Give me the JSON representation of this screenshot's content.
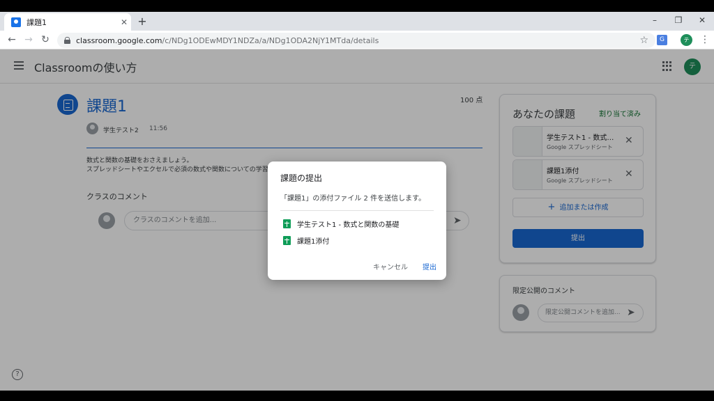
{
  "browser": {
    "tab_title": "課題1",
    "tab_close": "✕",
    "new_tab": "+",
    "url_host": "classroom.google.com",
    "url_path": "/c/NDg1ODEwMDY1NDZa/a/NDg1ODA2NjY1MTda/details",
    "window_minimize": "–",
    "window_restore": "❐",
    "window_close": "✕",
    "profile_initial": "テ"
  },
  "appbar": {
    "title": "Classroomの使い方",
    "account_initial": "テ"
  },
  "assignment": {
    "title": "課題1",
    "points": "100 点",
    "author": "学生テスト2",
    "time": "11:56",
    "description_line1": "数式と関数の基礎をおさえましょう。",
    "description_line2": "スプレッドシートやエクセルで必須の数式や関数についての学習",
    "class_comments_label": "クラスのコメント",
    "class_comment_placeholder": "クラスのコメントを追加..."
  },
  "your_work": {
    "title": "あなたの課題",
    "status": "割り当て済み",
    "attachments": [
      {
        "name": "学生テスト1 - 数式と関数の基礎",
        "type": "Google スプレッドシート"
      },
      {
        "name": "課題1添付",
        "type": "Google スプレッドシート"
      }
    ],
    "add_or_create": "追加または作成",
    "turn_in": "提出"
  },
  "private_comments": {
    "title": "限定公開のコメント",
    "placeholder": "限定公開コメントを追加..."
  },
  "dialog": {
    "title": "課題の提出",
    "message": "「課題1」の添付ファイル 2 件を送信します。",
    "files": [
      "学生テスト1 - 数式と関数の基礎",
      "課題1添付"
    ],
    "cancel": "キャンセル",
    "submit": "提出"
  },
  "colors": {
    "accent": "#1967d2",
    "assigned_status": "#137333",
    "sheets": "#0f9d58"
  }
}
